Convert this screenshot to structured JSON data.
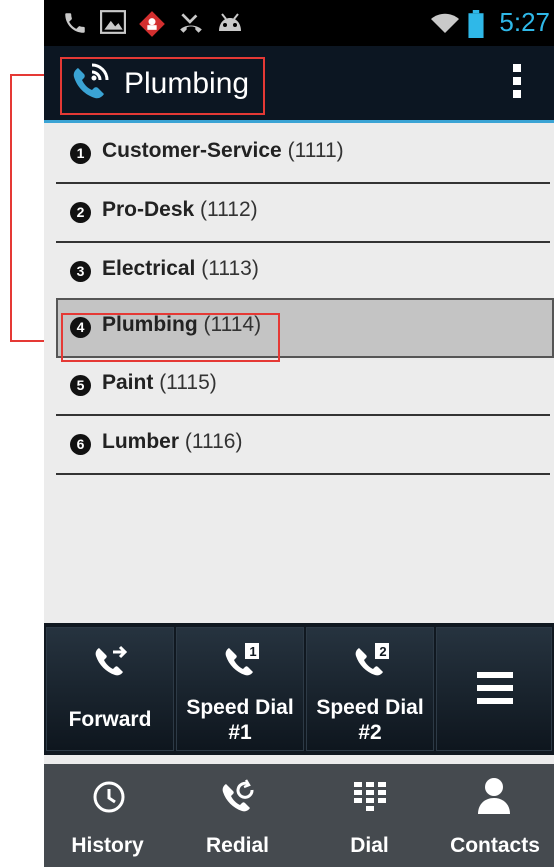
{
  "status_bar": {
    "time": "5:27"
  },
  "action_bar": {
    "title": "Plumbing"
  },
  "queues": [
    {
      "num": "1",
      "name": "Customer-Service",
      "ext": "(1111)"
    },
    {
      "num": "2",
      "name": "Pro-Desk",
      "ext": "(1112)"
    },
    {
      "num": "3",
      "name": "Electrical",
      "ext": "(1113)"
    },
    {
      "num": "4",
      "name": "Plumbing",
      "ext": "(1114)"
    },
    {
      "num": "5",
      "name": "Paint",
      "ext": "(1115)"
    },
    {
      "num": "6",
      "name": "Lumber",
      "ext": "(1116)"
    }
  ],
  "toolbar": {
    "forward": "Forward",
    "speed1_line1": "Speed Dial",
    "speed1_line2": "#1",
    "speed2_line1": "Speed Dial",
    "speed2_line2": "#2",
    "speed1_badge": "1",
    "speed2_badge": "2"
  },
  "bottom_nav": {
    "history": "History",
    "redial": "Redial",
    "dial": "Dial",
    "contacts": "Contacts"
  },
  "colors": {
    "accent": "#3aa3d4",
    "time": "#2fb8e8",
    "highlight": "#e53935",
    "selected_row": "#c4c4c4"
  }
}
